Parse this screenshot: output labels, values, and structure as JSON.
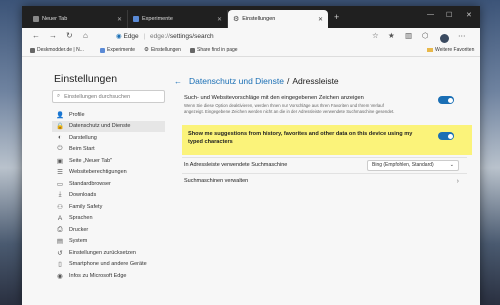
{
  "tabs": [
    {
      "label": "Neuer Tab"
    },
    {
      "label": "Experimente"
    },
    {
      "label": "Einstellungen"
    }
  ],
  "toolbar": {
    "browser_label": "Edge",
    "url_protocol": "edge://",
    "url_path": "settings/search"
  },
  "bookmarks": [
    {
      "label": "Deskmodder.de | N..."
    },
    {
      "label": "Experimente"
    },
    {
      "label": "Einstellungen"
    },
    {
      "label": "Share find in page"
    }
  ],
  "other_favorites": "Weitere Favoriten",
  "sidebar": {
    "title": "Einstellungen",
    "search_placeholder": "Einstellungen durchsuchen",
    "items": [
      {
        "label": "Profile",
        "icon": "person-icon",
        "glyph": "👤"
      },
      {
        "label": "Datenschutz und Dienste",
        "icon": "lock-icon",
        "glyph": "🔒",
        "active": true
      },
      {
        "label": "Darstellung",
        "icon": "palette-icon",
        "glyph": "◐"
      },
      {
        "label": "Beim Start",
        "icon": "power-icon",
        "glyph": "⏻"
      },
      {
        "label": "Seite „Neuer Tab\"",
        "icon": "new-tab-icon",
        "glyph": "▣"
      },
      {
        "label": "Websiteberechtigungen",
        "icon": "site-permissions-icon",
        "glyph": "☰"
      },
      {
        "label": "Standardbrowser",
        "icon": "browser-icon",
        "glyph": "▭"
      },
      {
        "label": "Downloads",
        "icon": "download-icon",
        "glyph": "⤓"
      },
      {
        "label": "Family Safety",
        "icon": "family-icon",
        "glyph": "⚇"
      },
      {
        "label": "Sprachen",
        "icon": "language-icon",
        "glyph": "A"
      },
      {
        "label": "Drucker",
        "icon": "printer-icon",
        "glyph": "⎙"
      },
      {
        "label": "System",
        "icon": "system-icon",
        "glyph": "▤"
      },
      {
        "label": "Einstellungen zurücksetzen",
        "icon": "reset-icon",
        "glyph": "↺"
      },
      {
        "label": "Smartphone und andere Geräte",
        "icon": "phone-icon",
        "glyph": "▯"
      },
      {
        "label": "Infos zu Microsoft Edge",
        "icon": "edge-icon",
        "glyph": "◉"
      }
    ]
  },
  "main": {
    "breadcrumb_parent": "Datenschutz und Dienste",
    "breadcrumb_sep": "/",
    "breadcrumb_current": "Adressleiste",
    "suggest_title": "Such- und Websitevorschläge mit den eingegebenen Zeichen anzeigen",
    "suggest_desc": "Wenn Sie diese Option deaktivieren, werden Ihnen nur Vorschläge aus Ihren Favoriten und Ihrem Verlauf angezeigt. Eingegebene Zeichen werden nicht an die in der Adressleiste verwendete Suchmaschine gesendet.",
    "suggest_toggle_on": true,
    "history_suggest_title": "Show me suggestions from history, favorites and other data on this device using my typed characters",
    "history_toggle_on": true,
    "engine_label": "In Adressleiste verwendete Suchmaschine",
    "engine_value": "Bing (Empfohlen, Standard)",
    "manage_label": "Suchmaschinen verwalten"
  },
  "colors": {
    "accent": "#1a6fb5",
    "highlight": "#fbf37a",
    "tab_strip": "#202020"
  }
}
